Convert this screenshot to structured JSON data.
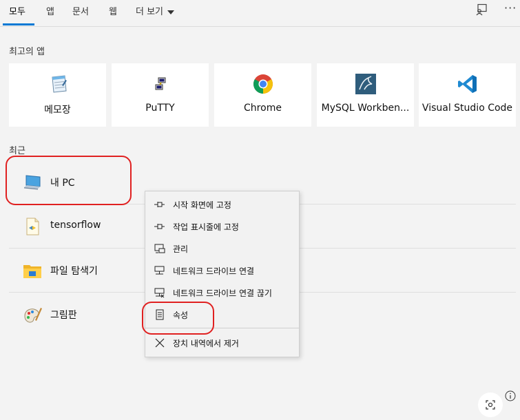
{
  "tabs": {
    "all": "모두",
    "apps": "앱",
    "documents": "문서",
    "web": "웹",
    "more": "더 보기"
  },
  "header": {
    "more_dots": "···"
  },
  "best_apps": {
    "title": "최고의 앱",
    "items": [
      {
        "label": "메모장",
        "icon": "notepad-icon"
      },
      {
        "label": "PuTTY",
        "icon": "putty-icon"
      },
      {
        "label": "Chrome",
        "icon": "chrome-icon"
      },
      {
        "label": "MySQL Workben...",
        "icon": "mysql-workbench-icon"
      },
      {
        "label": "Visual Studio Code",
        "icon": "vscode-icon"
      }
    ]
  },
  "recent": {
    "title": "최근",
    "items": [
      {
        "label": "내 PC",
        "icon": "computer-icon"
      },
      {
        "label": "tensorflow",
        "icon": "python-file-icon"
      },
      {
        "label": "파일 탐색기",
        "icon": "folder-icon"
      },
      {
        "label": "그림판",
        "icon": "paint-icon"
      }
    ]
  },
  "context_menu": {
    "items": [
      {
        "label": "시작 화면에 고정",
        "icon": "pin-icon"
      },
      {
        "label": "작업 표시줄에 고정",
        "icon": "pin-icon"
      },
      {
        "label": "관리",
        "icon": "manage-icon"
      },
      {
        "label": "네트워크 드라이브 연결",
        "icon": "network-drive-icon"
      },
      {
        "label": "네트워크 드라이브 연결 끊기",
        "icon": "network-drive-disconnect-icon"
      },
      {
        "label": "속성",
        "icon": "properties-icon"
      },
      {
        "label": "장치 내역에서 제거",
        "icon": "close-icon"
      }
    ]
  },
  "colors": {
    "accent": "#0078d4",
    "highlight": "#e02020"
  }
}
